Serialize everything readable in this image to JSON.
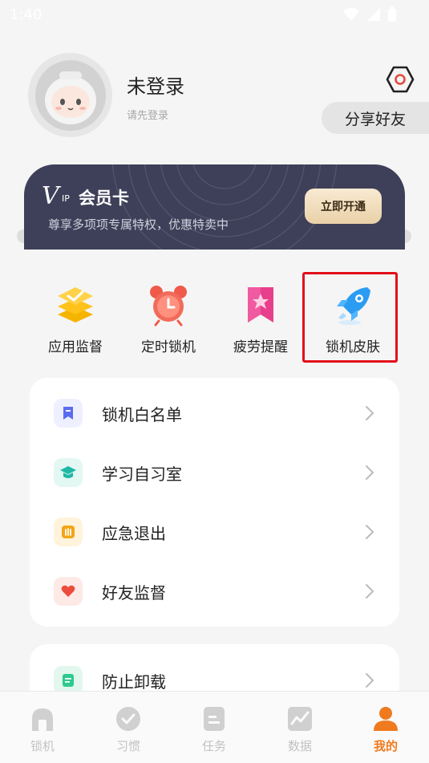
{
  "status_bar": {
    "time": "1:40"
  },
  "profile": {
    "username": "未登录",
    "login_hint": "请先登录",
    "share_label": "分享好友"
  },
  "vip": {
    "logo": "V",
    "logo_sub": "IP",
    "title": "会员卡",
    "subtitle": "尊享多项项专属特权，优惠特卖中",
    "button_label": "立即开通"
  },
  "features": [
    {
      "label": "应用监督",
      "icon": "app-monitor-icon"
    },
    {
      "label": "定时锁机",
      "icon": "alarm-clock-icon"
    },
    {
      "label": "疲劳提醒",
      "icon": "bookmark-star-icon"
    },
    {
      "label": "锁机皮肤",
      "icon": "rocket-icon"
    }
  ],
  "menu": [
    {
      "label": "锁机白名单",
      "icon": "bookmark-icon",
      "color": "#5b6cf0",
      "bg": "#eef0ff"
    },
    {
      "label": "学习自习室",
      "icon": "graduation-cap-icon",
      "color": "#1fb8a4",
      "bg": "#e3f7f3"
    },
    {
      "label": "应急退出",
      "icon": "hand-icon",
      "color": "#f2a516",
      "bg": "#fff3dc"
    },
    {
      "label": "好友监督",
      "icon": "heart-icon",
      "color": "#ec4c3c",
      "bg": "#fde9e6"
    },
    {
      "label": "防止卸载",
      "icon": "document-icon",
      "color": "#2ec98f",
      "bg": "#e2f7ee"
    }
  ],
  "nav": [
    {
      "label": "锁机",
      "icon": "lock-nav-icon"
    },
    {
      "label": "习惯",
      "icon": "check-circle-nav-icon"
    },
    {
      "label": "任务",
      "icon": "task-nav-icon"
    },
    {
      "label": "数据",
      "icon": "chart-nav-icon"
    },
    {
      "label": "我的",
      "icon": "profile-nav-icon",
      "active": true
    }
  ],
  "colors": {
    "accent": "#f07a1e",
    "vip_bg": "#3e3f58",
    "highlight": "#e30d1a"
  }
}
